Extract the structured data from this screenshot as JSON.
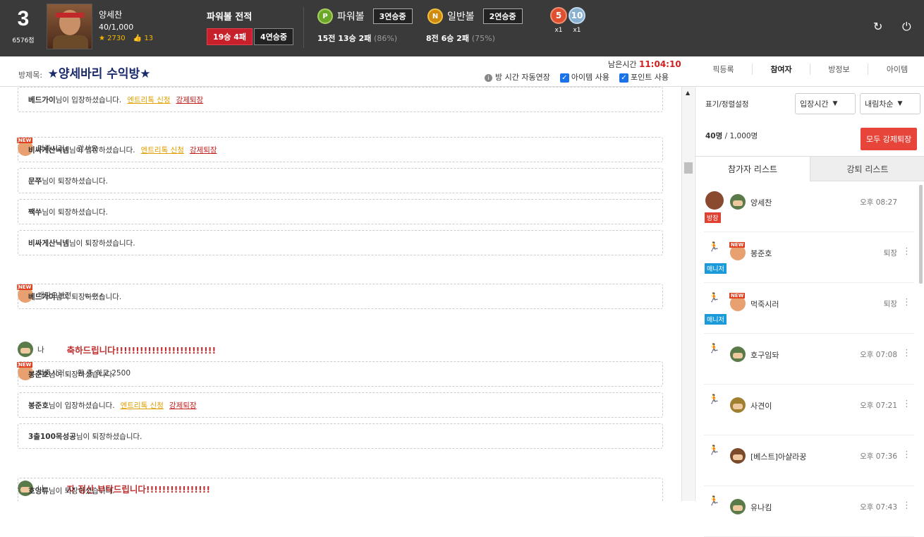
{
  "user": {
    "rank": "3",
    "points": "6576점",
    "name": "양세찬",
    "count": "40/1,000",
    "stars": "2730",
    "likes": "13"
  },
  "powerball_record": {
    "title": "파워볼 전적",
    "wl": "19승 4패",
    "streak": "4연승중"
  },
  "powerball": {
    "badge": "P",
    "label": "파워볼",
    "streak": "3연승중",
    "stat": "15전 13승 2패",
    "pct": "(86%)"
  },
  "normalball": {
    "badge": "N",
    "label": "일반볼",
    "streak": "2연승중",
    "stat": "8전 6승 2패",
    "pct": "(75%)"
  },
  "medals": [
    {
      "num": "5",
      "count": "x1"
    },
    {
      "num": "10",
      "count": "x1"
    }
  ],
  "icons": {
    "refresh": "↻",
    "power": "⏻"
  },
  "room": {
    "title_label": "방제목:",
    "title": "★양세바리 수익방★",
    "remain_label": "남은시간",
    "remain_time": "11:04:10",
    "auto_extend": "방 시간 자동연장",
    "item_use": "아이템 사용",
    "point_use": "포인트 사용",
    "tabs": [
      "픽등록",
      "참여자",
      "방정보",
      "아이템"
    ]
  },
  "chat": {
    "items": [
      {
        "type": "sys",
        "name": "베드가이",
        "text": "님이 입장하셨습니다.",
        "ylink": "엔트리톡 신청",
        "rlink": "강제퇴장"
      },
      {
        "type": "msg",
        "av": "new",
        "who": "먹죽시러",
        "text": "감사요"
      },
      {
        "type": "sys",
        "name": "비싸게산닉넴",
        "text": "님이 입장하셨습니다.",
        "ylink": "엔트리톡 신청",
        "rlink": "강제퇴장"
      },
      {
        "type": "sys",
        "name": "문쭈",
        "text": "님이 퇴장하셨습니다."
      },
      {
        "type": "sys",
        "name": "짹쑤",
        "text": "님이 퇴장하셨습니다."
      },
      {
        "type": "sys",
        "name": "비싸게산닉넴",
        "text": "님이 퇴장하셨습니다."
      },
      {
        "type": "msg",
        "av": "new",
        "who": "개판오분전",
        "text": "ㄴㅇㅅ"
      },
      {
        "type": "sys",
        "name": "베드가이",
        "text": "님이 퇴장하셨습니다."
      },
      {
        "type": "big",
        "av": "sol",
        "who": "나",
        "text": "축하드립니다!!!!!!!!!!!!!!!!!!!!!!!!!"
      },
      {
        "type": "msg",
        "av": "new",
        "who": "먹죽시러",
        "text": "환 충 하고 2500"
      },
      {
        "type": "sys",
        "name": "봉준호",
        "text": "님이 퇴장하셨습니다."
      },
      {
        "type": "sys",
        "name": "봉준호",
        "text": "님이 입장하셨습니다.",
        "ylink": "엔트리톡 신청",
        "rlink": "강제퇴장"
      },
      {
        "type": "sys",
        "name": "3출100목성공",
        "text": "님이 퇴장하셨습니다."
      },
      {
        "type": "big",
        "av": "sol",
        "who": "나",
        "text": "자 정산 부탁드립니다!!!!!!!!!!!!!!!!"
      },
      {
        "type": "sys",
        "name": "호잉류",
        "text": "님이 퇴장하셨습니다."
      }
    ]
  },
  "panel": {
    "sort_label": "표기/정렬설정",
    "sort_field": "입장시간",
    "sort_order": "내림차순",
    "count": "40명",
    "total": " / 1,000명",
    "kick_all": "모두 강제퇴장",
    "tab_participants": "참가자 리스트",
    "tab_kicked": "강퇴 리스트",
    "participants": [
      {
        "name": "양세찬",
        "time": "오후 08:27",
        "tag": "방장",
        "kind": "host",
        "lvl": "sol"
      },
      {
        "name": "봉준호",
        "time": "퇴장",
        "tag": "매니저",
        "kind": "mgr",
        "lvl": "new"
      },
      {
        "name": "먹죽시러",
        "time": "퇴장",
        "tag": "매니저",
        "kind": "mgr",
        "lvl": "new"
      },
      {
        "name": "호구임돠",
        "time": "오후 07:08",
        "tag": "",
        "kind": "",
        "lvl": "sol"
      },
      {
        "name": "사견이",
        "time": "오후 07:21",
        "tag": "",
        "kind": "",
        "lvl": "gold"
      },
      {
        "name": "[베스트]아샬라꿍",
        "time": "오후 07:36",
        "tag": "",
        "kind": "",
        "lvl": "brown"
      },
      {
        "name": "유나킴",
        "time": "오후 07:43",
        "tag": "",
        "kind": "",
        "lvl": "sol"
      }
    ]
  }
}
